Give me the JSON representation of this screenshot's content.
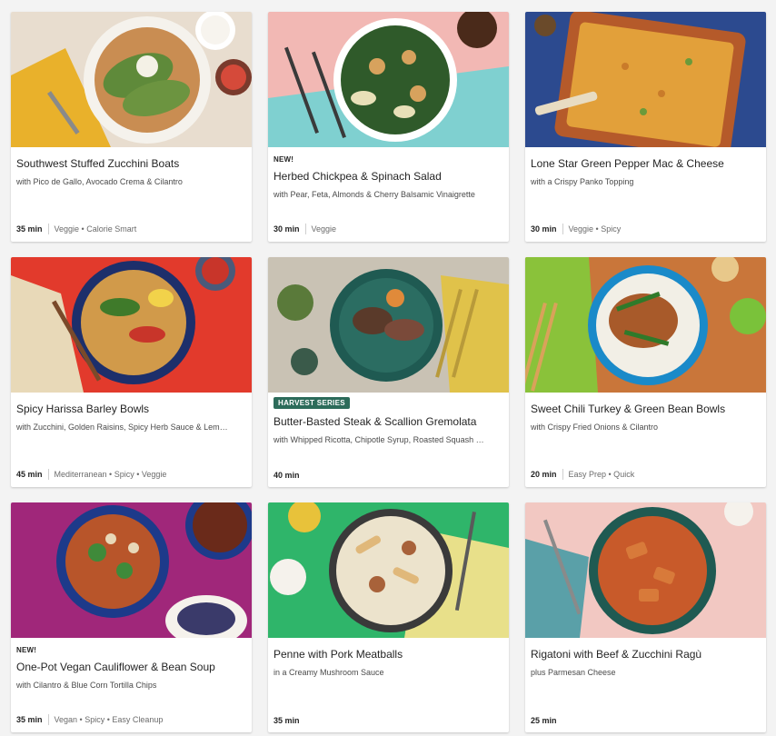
{
  "recipes": [
    {
      "title": "Southwest Stuffed Zucchini Boats",
      "subtitle": "with Pico de Gallo, Avocado Crema & Cilantro",
      "time": "35 min",
      "tags": "Veggie • Calorie Smart",
      "badge": "",
      "image_alt": "zucchini boats plate"
    },
    {
      "title": "Herbed Chickpea & Spinach Salad",
      "subtitle": "with Pear, Feta, Almonds & Cherry Balsamic Vinaigrette",
      "time": "30 min",
      "tags": "Veggie",
      "badge": "NEW!",
      "image_alt": "chickpea spinach salad bowl"
    },
    {
      "title": "Lone Star Green Pepper Mac & Cheese",
      "subtitle": "with a Crispy Panko Topping",
      "time": "30 min",
      "tags": "Veggie • Spicy",
      "badge": "",
      "image_alt": "mac and cheese baking dish"
    },
    {
      "title": "Spicy Harissa Barley Bowls",
      "subtitle": "with Zucchini, Golden Raisins, Spicy Herb Sauce & Lem…",
      "time": "45 min",
      "tags": "Mediterranean • Spicy • Veggie",
      "badge": "",
      "image_alt": "barley bowl"
    },
    {
      "title": "Butter-Basted Steak & Scallion Gremolata",
      "subtitle": "with Whipped Ricotta, Chipotle Syrup, Roasted Squash …",
      "time": "40 min",
      "tags": "",
      "badge": "HARVEST SERIES",
      "image_alt": "steak plate"
    },
    {
      "title": "Sweet Chili Turkey & Green Bean Bowls",
      "subtitle": "with Crispy Fried Onions & Cilantro",
      "time": "20 min",
      "tags": "Easy Prep • Quick",
      "badge": "",
      "image_alt": "turkey green bean bowl"
    },
    {
      "title": "One-Pot Vegan Cauliflower & Bean Soup",
      "subtitle": "with Cilantro & Blue Corn Tortilla Chips",
      "time": "35 min",
      "tags": "Vegan • Spicy • Easy Cleanup",
      "badge": "NEW!",
      "image_alt": "cauliflower bean soup"
    },
    {
      "title": "Penne with Pork Meatballs",
      "subtitle": "in a Creamy Mushroom Sauce",
      "time": "35 min",
      "tags": "",
      "badge": "",
      "image_alt": "penne pasta bowl"
    },
    {
      "title": "Rigatoni with Beef & Zucchini Ragù",
      "subtitle": "plus Parmesan Cheese",
      "time": "25 min",
      "tags": "",
      "badge": "",
      "image_alt": "rigatoni plate"
    }
  ]
}
